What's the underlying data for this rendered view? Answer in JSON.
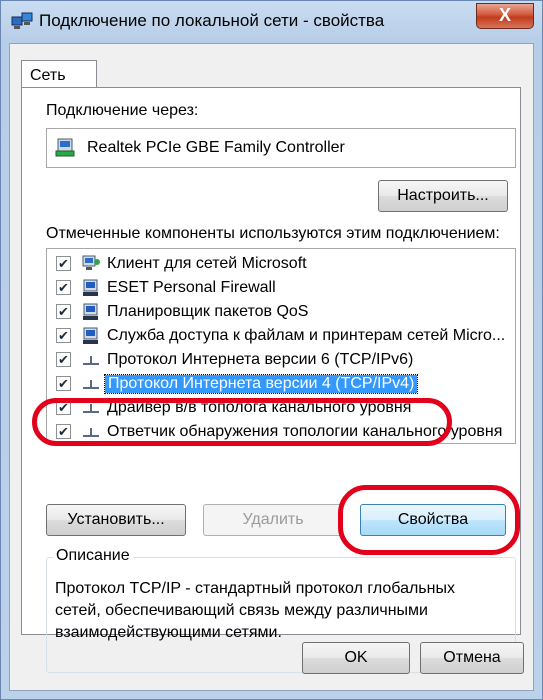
{
  "window": {
    "title": "Подключение по локальной сети - свойства",
    "close_label": "X"
  },
  "tabs": [
    {
      "label": "Сеть"
    }
  ],
  "connection": {
    "label": "Подключение через:",
    "adapter": "Realtek PCIe GBE Family Controller",
    "configure_label": "Настроить..."
  },
  "components": {
    "label": "Отмеченные компоненты используются этим подключением:",
    "items": [
      {
        "label": "Клиент для сетей Microsoft",
        "checked": true,
        "icon": "network-client-icon"
      },
      {
        "label": "ESET Personal Firewall",
        "checked": true,
        "icon": "network-service-icon"
      },
      {
        "label": "Планировщик пакетов QoS",
        "checked": true,
        "icon": "network-service-icon"
      },
      {
        "label": "Служба доступа к файлам и принтерам сетей Micro...",
        "checked": true,
        "icon": "network-service-icon"
      },
      {
        "label": "Протокол Интернета версии 6 (TCP/IPv6)",
        "checked": true,
        "icon": "protocol-icon"
      },
      {
        "label": "Протокол Интернета версии 4 (TCP/IPv4)",
        "checked": true,
        "icon": "protocol-icon",
        "selected": true
      },
      {
        "label": "Драйвер в/в тополога канального уровня",
        "checked": true,
        "icon": "protocol-icon"
      },
      {
        "label": "Ответчик обнаружения топологии канального уровня",
        "checked": true,
        "icon": "protocol-icon"
      }
    ]
  },
  "buttons": {
    "install": "Установить...",
    "remove": "Удалить",
    "properties": "Свойства",
    "ok": "OK",
    "cancel": "Отмена"
  },
  "description": {
    "title": "Описание",
    "text": "Протокол TCP/IP - стандартный протокол глобальных сетей, обеспечивающий связь между различными взаимодействующими сетями."
  },
  "colors": {
    "selection": "#3399ff",
    "annotation_red": "#e2001a",
    "focus_button": "#a7d9f5"
  }
}
